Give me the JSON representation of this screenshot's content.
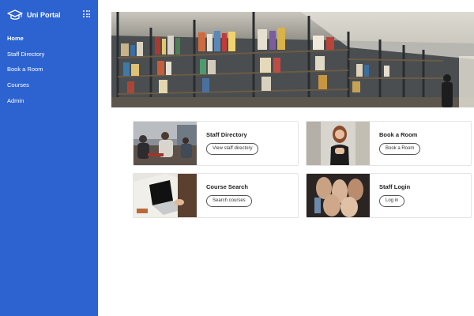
{
  "sidebar": {
    "brand": "Uni Portal",
    "nav": [
      {
        "label": "Home",
        "active": true
      },
      {
        "label": "Staff Directory",
        "active": false
      },
      {
        "label": "Book a Room",
        "active": false
      },
      {
        "label": "Courses",
        "active": false
      },
      {
        "label": "Admin",
        "active": false
      }
    ],
    "icons": {
      "brand": "graduation-cap-icon",
      "apps": "apps-grid-icon"
    },
    "color": "#2d63d0"
  },
  "hero": {
    "image": "library-bookshelves-photo"
  },
  "cards": [
    {
      "title": "Staff Directory",
      "button": "View staff directory",
      "image": "students-in-library-photo"
    },
    {
      "title": "Book a Room",
      "button": "Book a Room",
      "image": "woman-presenting-photo"
    },
    {
      "title": "Course Search",
      "button": "Search courses",
      "image": "laptop-on-desk-photo"
    },
    {
      "title": "Staff Login",
      "button": "Log in",
      "image": "hands-stacked-photo"
    }
  ]
}
